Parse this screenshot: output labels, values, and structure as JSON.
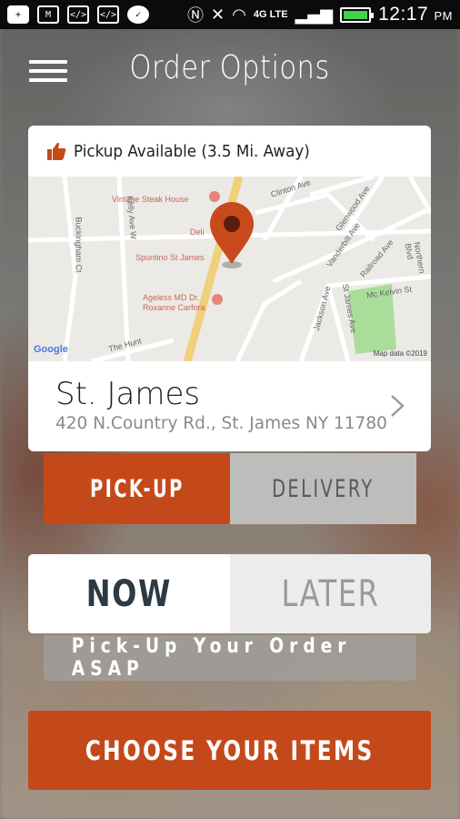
{
  "status_bar": {
    "time": "12:17",
    "ampm": "PM",
    "network": "4G LTE",
    "icons": [
      "add-icon",
      "gmail-icon",
      "code-icon",
      "code-icon",
      "chat-icon",
      "nfc-icon",
      "mute-icon",
      "wifi-icon",
      "signal-icon",
      "battery-icon"
    ]
  },
  "header": {
    "title": "Order Options"
  },
  "location_card": {
    "pickup_status": "Pickup Available (3.5 Mi. Away)",
    "store_name": "St. James",
    "store_address": "420 N.Country Rd., St. James NY 11780",
    "map": {
      "places": [
        "Vintage Steak House",
        "Deli",
        "Spuntino St James",
        "Ageless MD Dr. Roxanne Carfora"
      ],
      "streets": [
        "Clinton Ave",
        "Glenwood Ave",
        "Vanderbilt Ave",
        "Railroad Ave",
        "Northern Blvd",
        "Buckingham Ct",
        "Kelly Ave W",
        "Jackson Ave",
        "St James Ave",
        "Mc Kelvin St",
        "The Hunt"
      ],
      "attribution": "Map data ©2019",
      "brand": "Google"
    }
  },
  "fulfillment_toggle": {
    "pickup_label": "PICK-UP",
    "delivery_label": "DELIVERY",
    "selected": "pickup"
  },
  "timing_toggle": {
    "now_label": "NOW",
    "later_label": "LATER",
    "selected": "now",
    "note": "Pick-Up Your Order ASAP"
  },
  "cta": {
    "label": "CHOOSE YOUR ITEMS"
  },
  "colors": {
    "accent": "#c4491a",
    "pin": "#c84a1c"
  }
}
